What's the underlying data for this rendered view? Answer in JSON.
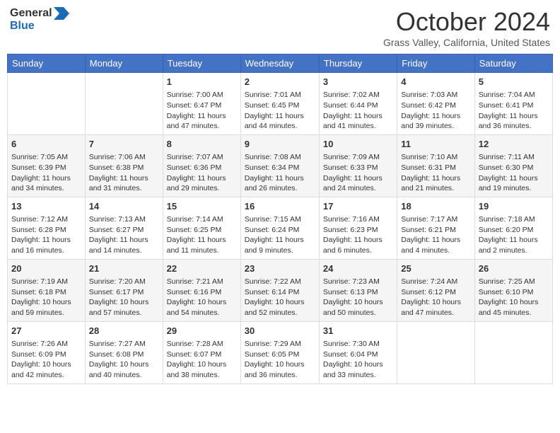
{
  "header": {
    "logo": {
      "line1": "General",
      "line2": "Blue"
    },
    "title": "October 2024",
    "location": "Grass Valley, California, United States"
  },
  "days_of_week": [
    "Sunday",
    "Monday",
    "Tuesday",
    "Wednesday",
    "Thursday",
    "Friday",
    "Saturday"
  ],
  "weeks": [
    [
      {
        "day": null
      },
      {
        "day": null
      },
      {
        "day": 1,
        "sunrise": "7:00 AM",
        "sunset": "6:47 PM",
        "daylight": "11 hours and 47 minutes."
      },
      {
        "day": 2,
        "sunrise": "7:01 AM",
        "sunset": "6:45 PM",
        "daylight": "11 hours and 44 minutes."
      },
      {
        "day": 3,
        "sunrise": "7:02 AM",
        "sunset": "6:44 PM",
        "daylight": "11 hours and 41 minutes."
      },
      {
        "day": 4,
        "sunrise": "7:03 AM",
        "sunset": "6:42 PM",
        "daylight": "11 hours and 39 minutes."
      },
      {
        "day": 5,
        "sunrise": "7:04 AM",
        "sunset": "6:41 PM",
        "daylight": "11 hours and 36 minutes."
      }
    ],
    [
      {
        "day": 6,
        "sunrise": "7:05 AM",
        "sunset": "6:39 PM",
        "daylight": "11 hours and 34 minutes."
      },
      {
        "day": 7,
        "sunrise": "7:06 AM",
        "sunset": "6:38 PM",
        "daylight": "11 hours and 31 minutes."
      },
      {
        "day": 8,
        "sunrise": "7:07 AM",
        "sunset": "6:36 PM",
        "daylight": "11 hours and 29 minutes."
      },
      {
        "day": 9,
        "sunrise": "7:08 AM",
        "sunset": "6:34 PM",
        "daylight": "11 hours and 26 minutes."
      },
      {
        "day": 10,
        "sunrise": "7:09 AM",
        "sunset": "6:33 PM",
        "daylight": "11 hours and 24 minutes."
      },
      {
        "day": 11,
        "sunrise": "7:10 AM",
        "sunset": "6:31 PM",
        "daylight": "11 hours and 21 minutes."
      },
      {
        "day": 12,
        "sunrise": "7:11 AM",
        "sunset": "6:30 PM",
        "daylight": "11 hours and 19 minutes."
      }
    ],
    [
      {
        "day": 13,
        "sunrise": "7:12 AM",
        "sunset": "6:28 PM",
        "daylight": "11 hours and 16 minutes."
      },
      {
        "day": 14,
        "sunrise": "7:13 AM",
        "sunset": "6:27 PM",
        "daylight": "11 hours and 14 minutes."
      },
      {
        "day": 15,
        "sunrise": "7:14 AM",
        "sunset": "6:25 PM",
        "daylight": "11 hours and 11 minutes."
      },
      {
        "day": 16,
        "sunrise": "7:15 AM",
        "sunset": "6:24 PM",
        "daylight": "11 hours and 9 minutes."
      },
      {
        "day": 17,
        "sunrise": "7:16 AM",
        "sunset": "6:23 PM",
        "daylight": "11 hours and 6 minutes."
      },
      {
        "day": 18,
        "sunrise": "7:17 AM",
        "sunset": "6:21 PM",
        "daylight": "11 hours and 4 minutes."
      },
      {
        "day": 19,
        "sunrise": "7:18 AM",
        "sunset": "6:20 PM",
        "daylight": "11 hours and 2 minutes."
      }
    ],
    [
      {
        "day": 20,
        "sunrise": "7:19 AM",
        "sunset": "6:18 PM",
        "daylight": "10 hours and 59 minutes."
      },
      {
        "day": 21,
        "sunrise": "7:20 AM",
        "sunset": "6:17 PM",
        "daylight": "10 hours and 57 minutes."
      },
      {
        "day": 22,
        "sunrise": "7:21 AM",
        "sunset": "6:16 PM",
        "daylight": "10 hours and 54 minutes."
      },
      {
        "day": 23,
        "sunrise": "7:22 AM",
        "sunset": "6:14 PM",
        "daylight": "10 hours and 52 minutes."
      },
      {
        "day": 24,
        "sunrise": "7:23 AM",
        "sunset": "6:13 PM",
        "daylight": "10 hours and 50 minutes."
      },
      {
        "day": 25,
        "sunrise": "7:24 AM",
        "sunset": "6:12 PM",
        "daylight": "10 hours and 47 minutes."
      },
      {
        "day": 26,
        "sunrise": "7:25 AM",
        "sunset": "6:10 PM",
        "daylight": "10 hours and 45 minutes."
      }
    ],
    [
      {
        "day": 27,
        "sunrise": "7:26 AM",
        "sunset": "6:09 PM",
        "daylight": "10 hours and 42 minutes."
      },
      {
        "day": 28,
        "sunrise": "7:27 AM",
        "sunset": "6:08 PM",
        "daylight": "10 hours and 40 minutes."
      },
      {
        "day": 29,
        "sunrise": "7:28 AM",
        "sunset": "6:07 PM",
        "daylight": "10 hours and 38 minutes."
      },
      {
        "day": 30,
        "sunrise": "7:29 AM",
        "sunset": "6:05 PM",
        "daylight": "10 hours and 36 minutes."
      },
      {
        "day": 31,
        "sunrise": "7:30 AM",
        "sunset": "6:04 PM",
        "daylight": "10 hours and 33 minutes."
      },
      {
        "day": null
      },
      {
        "day": null
      }
    ]
  ],
  "labels": {
    "sunrise": "Sunrise:",
    "sunset": "Sunset:",
    "daylight": "Daylight:"
  }
}
